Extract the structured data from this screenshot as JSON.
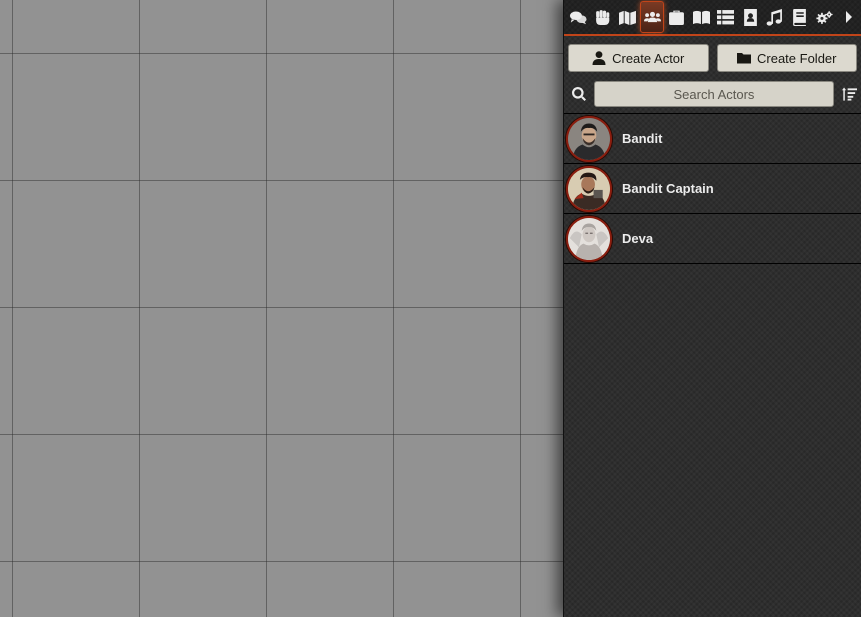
{
  "sidebar": {
    "tabs": [
      {
        "name": "chat",
        "icon": "comments-icon"
      },
      {
        "name": "combat",
        "icon": "fist-icon"
      },
      {
        "name": "scenes",
        "icon": "map-icon"
      },
      {
        "name": "actors",
        "icon": "users-icon",
        "active": true
      },
      {
        "name": "items",
        "icon": "suitcase-icon"
      },
      {
        "name": "journal",
        "icon": "book-open-icon"
      },
      {
        "name": "tables",
        "icon": "table-list-icon"
      },
      {
        "name": "cards",
        "icon": "id-badge-icon"
      },
      {
        "name": "playlists",
        "icon": "music-icon"
      },
      {
        "name": "compendium",
        "icon": "atlas-icon"
      },
      {
        "name": "settings",
        "icon": "cogs-icon"
      },
      {
        "name": "collapse",
        "icon": "caret-right-icon"
      }
    ],
    "accent_color": "#c14419"
  },
  "actors": {
    "create_actor_label": "Create Actor",
    "create_folder_label": "Create Folder",
    "search_placeholder": "Search Actors",
    "items": [
      {
        "name": "Bandit"
      },
      {
        "name": "Bandit Captain"
      },
      {
        "name": "Deva"
      }
    ]
  }
}
